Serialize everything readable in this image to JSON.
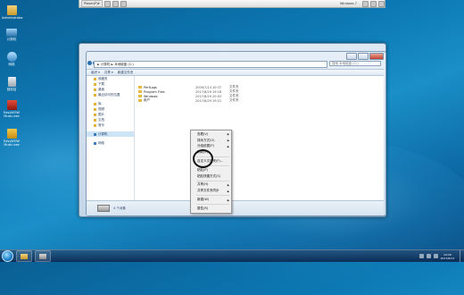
{
  "vm_toolbar": {
    "player_label": "Player(P)",
    "guest_title": "Windows 7",
    "icons": [
      "pause-icon",
      "power-icon",
      "send-keys-icon",
      "fullscreen-icon",
      "usb-icon",
      "settings-icon"
    ]
  },
  "desktop": {
    "icons": [
      {
        "label": "Administrator",
        "icon": "user-folder-icon"
      },
      {
        "label": "计算机",
        "icon": "computer-icon"
      },
      {
        "label": "网络",
        "icon": "network-icon"
      },
      {
        "label": "回收站",
        "icon": "recycle-bin-icon"
      },
      {
        "label": "EasyWOW Music.exe",
        "icon": "exe-icon"
      },
      {
        "label": "EasyWOW Music.exe",
        "icon": "exe-icon"
      }
    ]
  },
  "explorer": {
    "address": "► 计算机 ► 本地磁盘 (C:)",
    "search_placeholder": "搜索 本地磁盘 (C:)",
    "commands": [
      "组织 ▾",
      "共享 ▾",
      "新建文件夹"
    ],
    "nav": [
      {
        "label": "收藏夹",
        "type": "group"
      },
      {
        "label": "下载",
        "type": "item"
      },
      {
        "label": "桌面",
        "type": "item"
      },
      {
        "label": "最近访问的位置",
        "type": "item"
      },
      {
        "label": "库",
        "type": "group"
      },
      {
        "label": "视频",
        "type": "item"
      },
      {
        "label": "图片",
        "type": "item"
      },
      {
        "label": "文档",
        "type": "item"
      },
      {
        "label": "音乐",
        "type": "item"
      },
      {
        "label": "计算机",
        "type": "group-selected"
      },
      {
        "label": "网络",
        "type": "group"
      }
    ],
    "files": [
      {
        "name": "PerfLogs",
        "date": "2009/7/14 10:37",
        "type": "文件夹"
      },
      {
        "name": "Program Files",
        "date": "2017/8/29 19:18",
        "type": "文件夹"
      },
      {
        "name": "Windows",
        "date": "2017/8/29 20:03",
        "type": "文件夹"
      },
      {
        "name": "用户",
        "date": "2017/8/29 19:21",
        "type": "文件夹"
      }
    ],
    "status": "4 个对象"
  },
  "context_menu": {
    "items": [
      {
        "label": "查看(V)",
        "arrow": true
      },
      {
        "label": "排序方式(O)",
        "arrow": true
      },
      {
        "label": "分组依据(P)",
        "arrow": true
      },
      {
        "label": "刷新(E)",
        "arrow": false
      },
      {
        "sep": true
      },
      {
        "label": "自定义文件夹(F)...",
        "arrow": false
      },
      {
        "sep": true
      },
      {
        "label": "粘贴(P)",
        "arrow": false
      },
      {
        "label": "粘贴快捷方式(S)",
        "arrow": false
      },
      {
        "sep": true
      },
      {
        "label": "共享(H)",
        "arrow": true
      },
      {
        "label": "共享文件夹同步",
        "arrow": true
      },
      {
        "sep": true
      },
      {
        "label": "新建(W)",
        "arrow": true
      },
      {
        "sep": true
      },
      {
        "label": "属性(R)",
        "arrow": false
      }
    ]
  },
  "taskbar": {
    "pinned": [
      "explorer-icon",
      "vmware-icon"
    ],
    "time": "19:28",
    "date": "2017/8/13"
  },
  "colors": {
    "accent": "#1d7ec6",
    "highlight_circle": "#111111"
  }
}
